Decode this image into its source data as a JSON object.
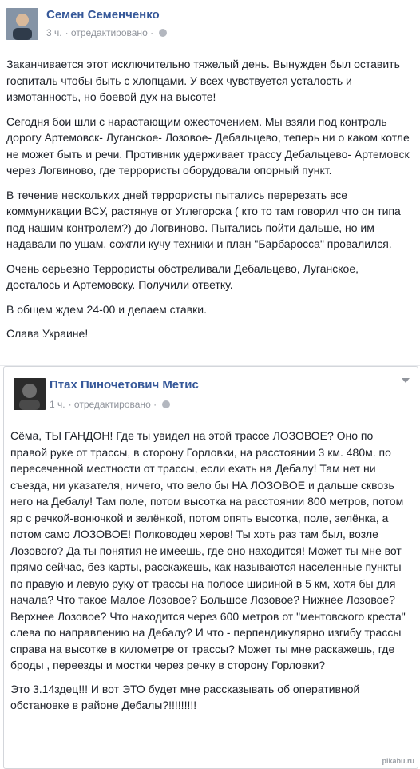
{
  "post1": {
    "author": "Семен Семенченко",
    "time": "3 ч.",
    "edited": "· отредактировано ·",
    "icons": {
      "avatar": "avatar-photo",
      "privacy": "globe-icon"
    },
    "paragraphs": [
      "Заканчивается этот исключительно тяжелый день. Вынужден был оставить госпиталь чтобы быть с хлопцами. У всех чувствуется усталость и измотанность, но боевой дух на высоте!",
      "Сегодня бои шли с нарастающим ожесточением. Мы взяли под контроль дорогу Артемовск- Луганское- Лозовое- Дебальцево, теперь ни о каком котле не может быть и речи. Противник удерживает трассу Дебальцево- Артемовск через Логвиново, где террористы оборудовали опорный пункт.",
      "В течение нескольких дней террористы пытались перерезать все коммуникации ВСУ, растянув от Углегорска ( кто то там говорил что он типа под нашим контролем?) до Логвиново. Пытались пойти дальше, но им надавали по ушам, сожгли кучу техники и план \"Барбаросса\" провалился.",
      "Очень серьезно Террористы обстреливали Дебальцево, Луганское, досталось и Артемовску. Получили ответку.",
      "В общем ждем 24-00 и делаем ставки.",
      "Слава Украине!"
    ]
  },
  "post2": {
    "author": "Птах Пиночетович Метис",
    "time": "1 ч.",
    "edited": "· отредактировано ·",
    "icons": {
      "avatar": "avatar-photo",
      "privacy": "globe-icon",
      "menu": "chevron-down-icon"
    },
    "paragraphs": [
      "Сёма, ТЫ ГАНДОН! Где ты увидел на этой трассе ЛОЗОВОЕ? Оно по правой руке от трассы, в сторону Горловки, на расстоянии 3 км. 480м. по пересеченной местности от трассы, если ехать на Дебалу! Там нет ни съезда, ни указателя, ничего, что вело бы НА ЛОЗОВОЕ и дальше сквозь него на Дебалу! Там поле, потом высотка на расстоянии 800 метров, потом яр с речкой-вонючкой и зелёнкой, потом опять высотка, поле, зелёнка, а потом само ЛОЗОВОЕ! Полководец херов! Ты хоть раз там был, возле Лозового? Да ты понятия не имеешь, где оно находится! Может ты мне вот прямо сейчас, без карты, расскажешь, как называются населенные пункты по правую и левую руку от трассы на полосе шириной в 5 км, хотя бы для начала? Что такое Малое Лозовое? Большое Лозовое? Нижнее Лозовое? Верхнее Лозовое? Что находится через 600 метров от \"ментовского креста\" слева по направлению на Дебалу? И что - перпендикулярно изгибу трассы справа на высотке в километре от трассы? Может ты мне раскажешь, где броды , переезды и мостки через речку в сторону Горловки?",
      "Это 3.14здец!!! И вот ЭТО будет мне рассказывать об оперативной обстановке в районе Дебалы?!!!!!!!!!"
    ]
  },
  "watermark": "pikabu.ru"
}
